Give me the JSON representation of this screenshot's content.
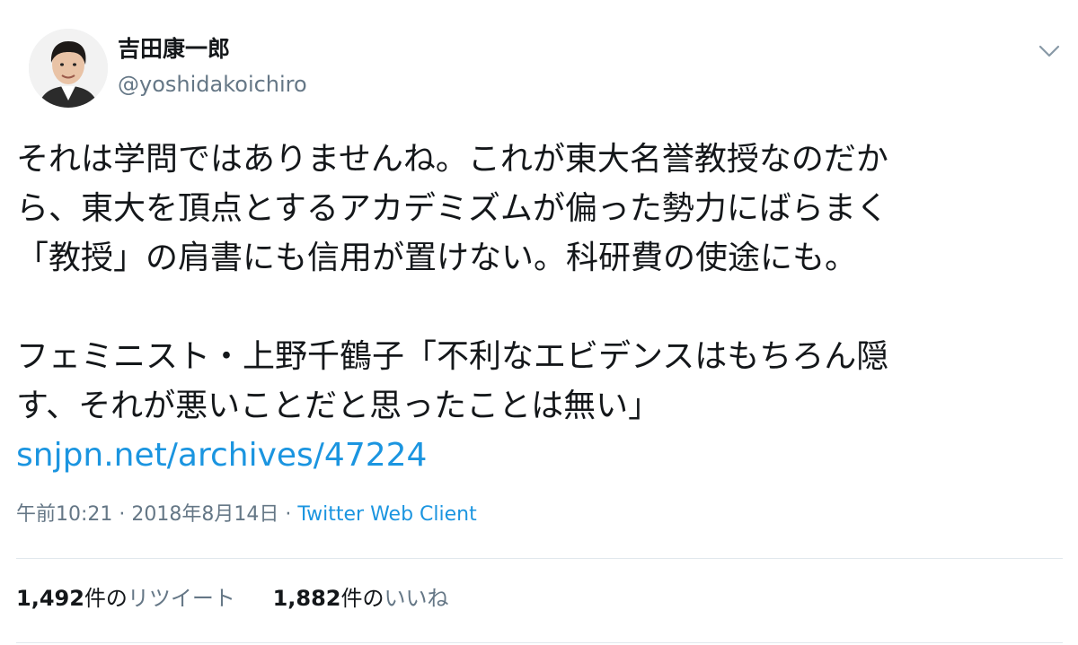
{
  "author": {
    "display_name": "吉田康一郎",
    "handle": "@yoshidakoichiro"
  },
  "tweet": {
    "lines": [
      "それは学問ではありませんね。これが東大名誉教授なのだか",
      "ら、東大を頂点とするアカデミズムが偏った勢力にばらまく",
      "「教授」の肩書にも信用が置けない。科研費の使途にも。",
      "",
      "フェミニスト・上野千鶴子「不利なエビデンスはもちろん隠",
      "す、それが悪いことだと思ったことは無い」"
    ],
    "link": "snjpn.net/archives/47224"
  },
  "meta": {
    "time": "午前10:21",
    "separator": " · ",
    "date": "2018年8月14日",
    "source": "Twitter Web Client"
  },
  "stats": {
    "retweets": {
      "count": "1,492",
      "unit": "件の",
      "label": "リツイート"
    },
    "likes": {
      "count": "1,882",
      "unit": "件の",
      "label": "いいね"
    }
  },
  "icons": {
    "menu": "chevron-down-icon"
  },
  "colors": {
    "text": "#14171a",
    "secondary": "#657786",
    "link": "#1b95e0",
    "divider": "#e1e8ed"
  }
}
